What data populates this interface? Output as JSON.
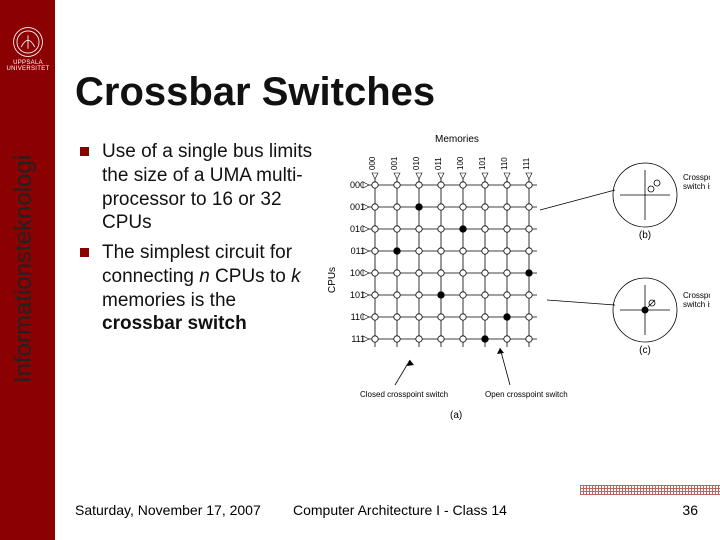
{
  "sidebar": {
    "logo_alt": "Uppsala Universitet seal",
    "logo_label": "UPPSALA UNIVERSITET",
    "vertical": "Informationsteknologi"
  },
  "title": "Crossbar Switches",
  "bullets": [
    "Use of a single bus limits the size of a UMA multi-processor to 16 or 32 CPUs",
    "The simplest circuit for connecting <em>n</em> CPUs to <em>k</em> memories is the <b>crossbar switch</b>"
  ],
  "figure": {
    "top_label": "Memories",
    "side_label": "CPUs",
    "col_labels": [
      "000",
      "001",
      "010",
      "011",
      "100",
      "101",
      "110",
      "111"
    ],
    "row_labels": [
      "000",
      "001",
      "010",
      "011",
      "100",
      "101",
      "110",
      "111"
    ],
    "callouts": {
      "open": "Crosspoint switch is open",
      "closed_inset": "Crosspoint switch is closed",
      "closed_arrow": "Closed crosspoint switch",
      "open_arrow": "Open crosspoint switch"
    },
    "sub_a": "(a)",
    "sub_b": "(b)",
    "sub_c": "(c)"
  },
  "footer": {
    "date": "Saturday, November 17, 2007",
    "center": "Computer Architecture I - Class 14",
    "page": "36"
  }
}
